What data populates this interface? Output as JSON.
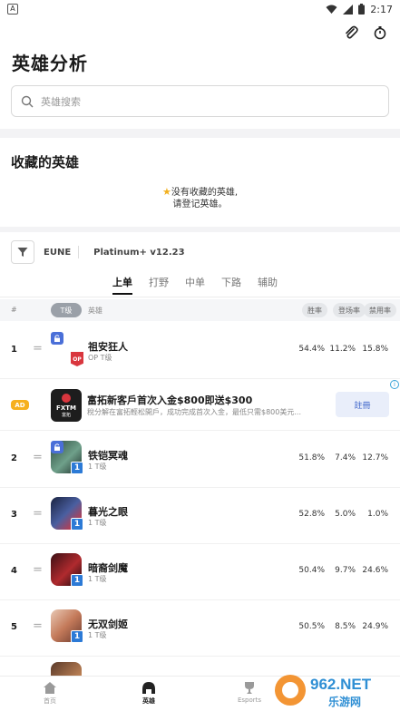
{
  "status_bar": {
    "time": "2:17",
    "left_badge": "A"
  },
  "header": {
    "title": "英雄分析"
  },
  "search": {
    "placeholder": "英雄搜索"
  },
  "favorites": {
    "title": "收藏的英雄",
    "empty_line1": "没有收藏的英雄,",
    "empty_line2": "请登记英雄。"
  },
  "filters": {
    "region": "EUNE",
    "tier_version": "Platinum+  v12.23"
  },
  "lanes": [
    {
      "label": "上单",
      "active": true
    },
    {
      "label": "打野",
      "active": false
    },
    {
      "label": "中单",
      "active": false
    },
    {
      "label": "下路",
      "active": false
    },
    {
      "label": "辅助",
      "active": false
    }
  ],
  "table_header": {
    "hash": "#",
    "tier": "T级",
    "hero": "英雄",
    "win_rate": "胜率",
    "pick_rate": "登场率",
    "ban_rate": "禁用率"
  },
  "rows": [
    {
      "rank": "1",
      "name": "祖安狂人",
      "tier": "OP T级",
      "win": "54.4%",
      "pick": "11.2%",
      "ban": "15.8%",
      "op": "OP",
      "badge": ""
    },
    {
      "rank": "2",
      "name": "铁铠冥魂",
      "tier": "1 T级",
      "win": "51.8%",
      "pick": "7.4%",
      "ban": "12.7%",
      "badge": "1"
    },
    {
      "rank": "3",
      "name": "暮光之眼",
      "tier": "1 T级",
      "win": "52.8%",
      "pick": "5.0%",
      "ban": "1.0%",
      "badge": "1"
    },
    {
      "rank": "4",
      "name": "暗裔剑魔",
      "tier": "1 T级",
      "win": "50.4%",
      "pick": "9.7%",
      "ban": "24.6%",
      "badge": "1"
    },
    {
      "rank": "5",
      "name": "无双剑姬",
      "tier": "1 T级",
      "win": "50.5%",
      "pick": "8.5%",
      "ban": "24.9%",
      "badge": "1"
    }
  ],
  "ad": {
    "badge": "AD",
    "logo_text": "FXTM",
    "logo_sub": "富拓",
    "title": "富拓新客戶首次入金$800即送$300",
    "description": "稅分解在富拓輕松開戶，成功完成首次入金，最低只需$800美元...",
    "button": "註冊",
    "info": "i"
  },
  "bottom_nav": [
    {
      "label": "首页",
      "icon": "home-icon",
      "active": false
    },
    {
      "label": "英雄",
      "icon": "helmet-icon",
      "active": true
    },
    {
      "label": "Esports",
      "icon": "trophy-icon",
      "active": false
    }
  ],
  "watermark": {
    "text": "962.NET",
    "sub": "乐游网"
  },
  "colors": {
    "accent_blue": "#2c7ad6",
    "ad_yellow": "#f6b01e",
    "op_red": "#d9363e"
  }
}
